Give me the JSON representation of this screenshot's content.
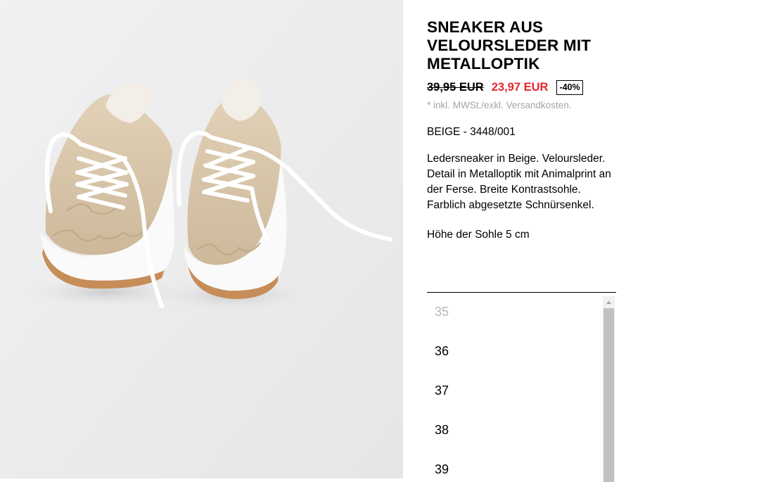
{
  "product": {
    "title": "SNEAKER AUS VELOURSLEDER MIT METALLOPTIK",
    "old_price": "39,95 EUR",
    "new_price": "23,97 EUR",
    "discount": "-40%",
    "tax_note": "* inkl. MWSt./exkl. Versandkosten.",
    "color_ref": "BEIGE - 3448/001",
    "description": "Ledersneaker in Beige. Veloursleder. Detail in Metalloptik mit Animalprint an der Ferse. Breite Kontrastsohle. Farblich abgesetzte Schnürsenkel.",
    "sole_height": "Höhe der Sohle 5 cm"
  },
  "sizes": {
    "items": [
      {
        "label": "35",
        "available": false
      },
      {
        "label": "36",
        "available": true
      },
      {
        "label": "37",
        "available": true
      },
      {
        "label": "38",
        "available": true
      },
      {
        "label": "39",
        "available": true
      }
    ]
  },
  "colors": {
    "sale_price": "#e5272d",
    "unavailable_size": "#b7b7b7",
    "tax_note": "#a5a5a5",
    "image_background": "#ebebec",
    "shoe_suede": "#d9c7ab",
    "sole": "#ffffff",
    "outsole": "#c78d58"
  },
  "icons": {
    "scroll_up": "triangle-up"
  }
}
